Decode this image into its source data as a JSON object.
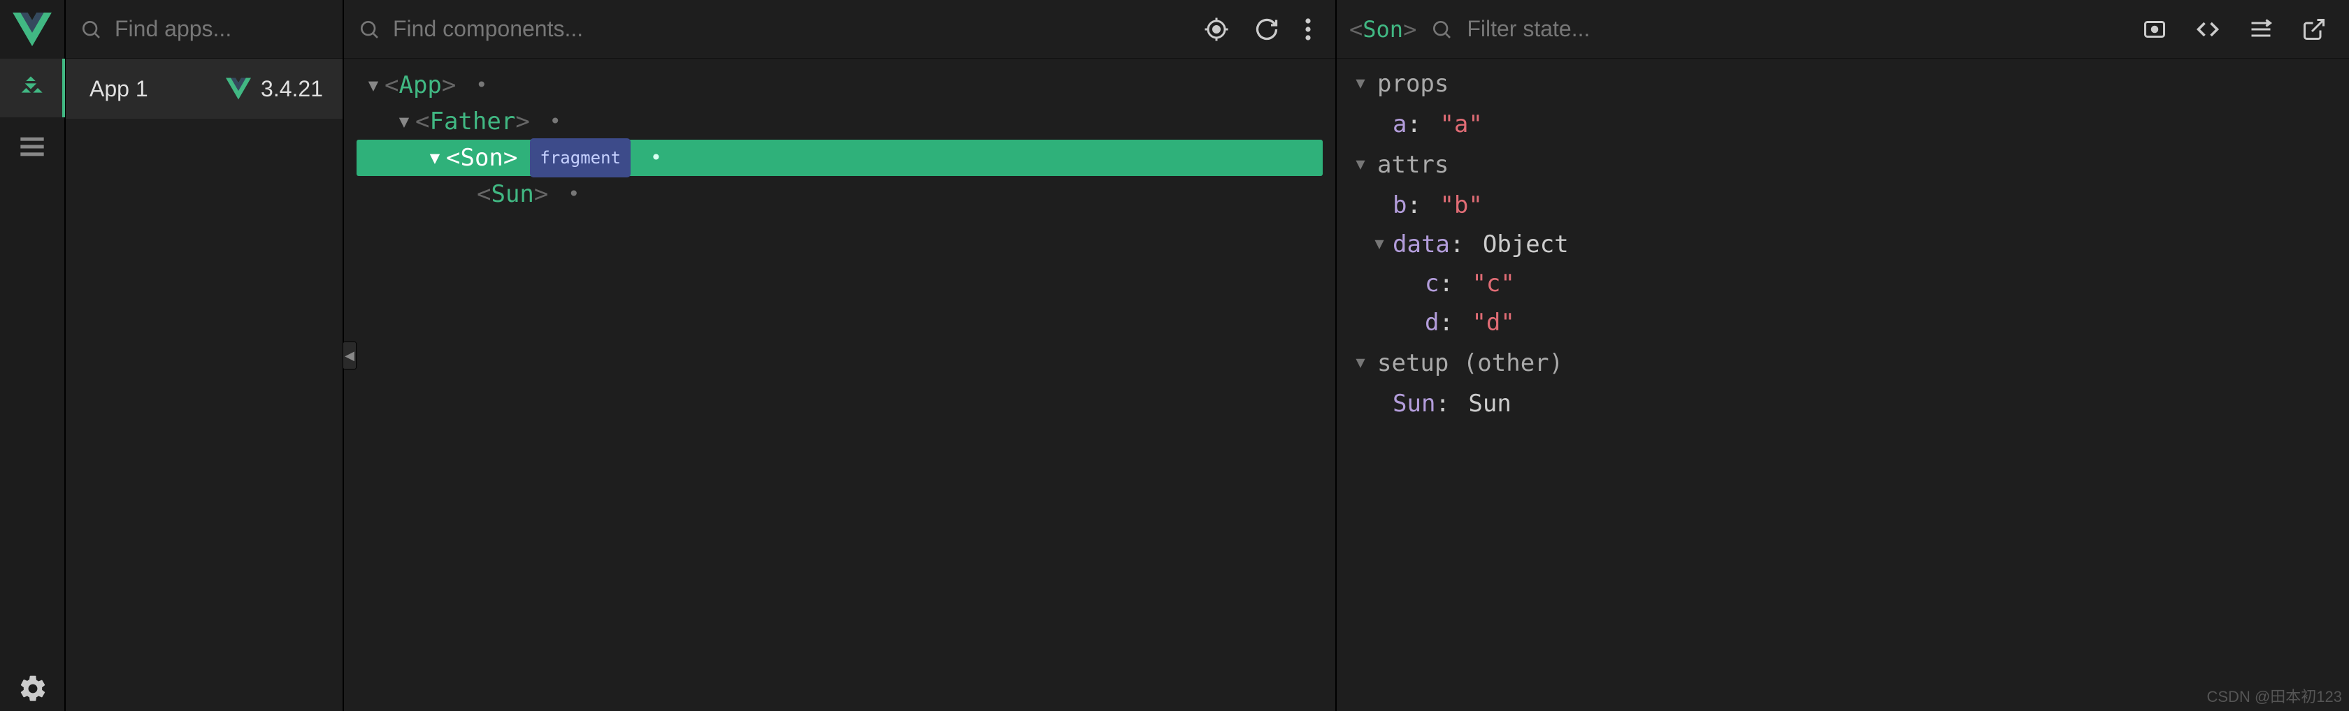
{
  "sidebar": {
    "logo_color": "#41b883"
  },
  "apps": {
    "search_placeholder": "Find apps...",
    "items": [
      {
        "name": "App 1",
        "version": "3.4.21"
      }
    ]
  },
  "components": {
    "search_placeholder": "Find components...",
    "tree": {
      "root": {
        "name": "App"
      },
      "father": {
        "name": "Father"
      },
      "son": {
        "name": "Son",
        "badge": "fragment"
      },
      "sun": {
        "name": "Sun"
      }
    }
  },
  "state": {
    "selected_component": "Son",
    "filter_placeholder": "Filter state...",
    "sections": {
      "props": {
        "label": "props",
        "entries": [
          {
            "key": "a",
            "value": "\"a\""
          }
        ]
      },
      "attrs": {
        "label": "attrs",
        "entries": [
          {
            "key": "b",
            "value": "\"b\""
          }
        ],
        "data_obj": {
          "key": "data",
          "type": "Object",
          "children": [
            {
              "key": "c",
              "value": "\"c\""
            },
            {
              "key": "d",
              "value": "\"d\""
            }
          ]
        }
      },
      "setup": {
        "label": "setup (other)",
        "entries": [
          {
            "key": "Sun",
            "value": "Sun"
          }
        ]
      }
    }
  },
  "watermark": "CSDN @田本初123"
}
